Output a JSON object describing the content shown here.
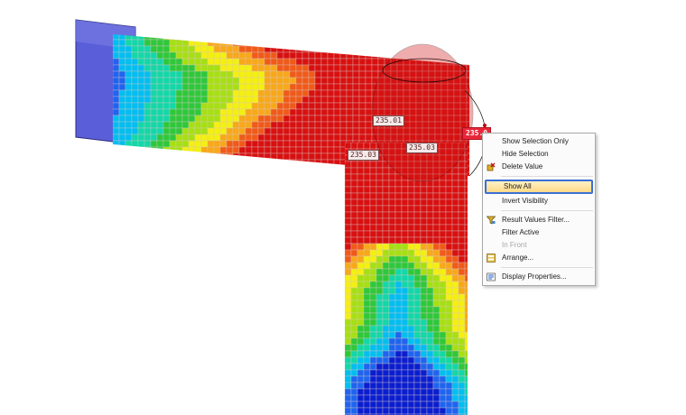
{
  "viewport": {
    "result_labels": [
      {
        "text": "235.01"
      },
      {
        "text": "235.03"
      },
      {
        "text": "235.03"
      },
      {
        "text": "235.0"
      }
    ]
  },
  "colors": {
    "pipe_blue": "#5a5ed8",
    "mesh_line": "#d9c6c6",
    "highlight_border": "#3b6fd4",
    "highlight_fill": "#ffd987",
    "scale": [
      "#0a1ed0",
      "#1e64f0",
      "#00bef0",
      "#12d8a8",
      "#2ec83a",
      "#a6e012",
      "#f4f010",
      "#f8a818",
      "#f05a18",
      "#d81010"
    ]
  },
  "context_menu": {
    "items": [
      {
        "label": "Show Selection Only",
        "icon": "none",
        "enabled": true
      },
      {
        "label": "Hide Selection",
        "icon": "none",
        "enabled": true
      },
      {
        "label": "Delete Value",
        "icon": "delete-value-icon",
        "enabled": true
      },
      {
        "label": "Show All",
        "icon": "none",
        "enabled": true,
        "highlighted": true
      },
      {
        "label": "Invert Visibility",
        "icon": "none",
        "enabled": true
      },
      {
        "label": "Result Values Filter...",
        "icon": "filter-icon",
        "enabled": true
      },
      {
        "label": "Filter Active",
        "icon": "none",
        "enabled": true
      },
      {
        "label": "In Front",
        "icon": "none",
        "enabled": false
      },
      {
        "label": "Arrange...",
        "icon": "arrange-icon",
        "enabled": true
      },
      {
        "label": "Display Properties...",
        "icon": "display-properties-icon",
        "enabled": true
      }
    ]
  }
}
